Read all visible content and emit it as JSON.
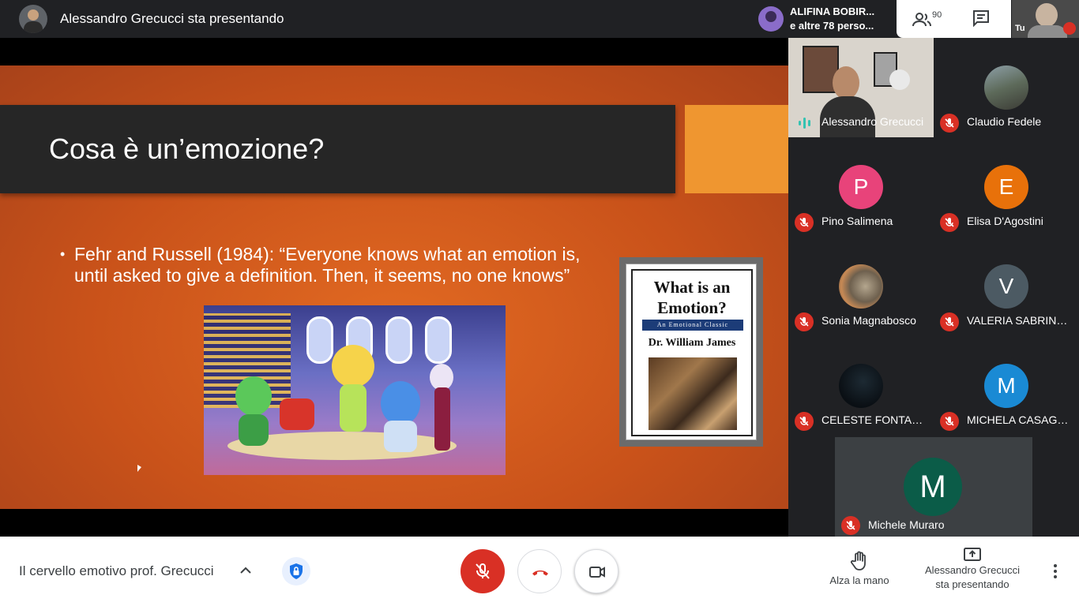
{
  "topbar": {
    "presenter_title": "Alessandro Grecucci sta presentando",
    "people_chip_line1": "ALIFINA BOBIR...",
    "people_chip_line2": "e altre 78 perso...",
    "participant_count": "90",
    "self_label": "Tu"
  },
  "slide": {
    "title": "Cosa è un’emozione?",
    "bullet": "Fehr and Russell (1984): “Everyone knows what an emotion is, until asked to give a definition. Then, it seems, no one knows”",
    "book": {
      "title": "What is an Emotion?",
      "subtitle": "An Emotional Classic",
      "author": "Dr. William James"
    }
  },
  "participants": [
    {
      "name": "Alessandro Grecucci",
      "type": "video",
      "speaking": true
    },
    {
      "name": "Claudio Fedele",
      "type": "photo",
      "muted": true
    },
    {
      "name": "Pino Salimena",
      "initial": "P",
      "color": "#e8437a",
      "muted": true
    },
    {
      "name": "Elisa D'Agostini",
      "initial": "E",
      "color": "#e8710a",
      "muted": true
    },
    {
      "name": "Sonia Magnabosco",
      "type": "photo",
      "muted": true
    },
    {
      "name": "VALERIA SABRINA ...",
      "initial": "V",
      "color": "#4c5a63",
      "muted": true
    },
    {
      "name": "CELESTE FONTAN...",
      "type": "photo",
      "muted": true
    },
    {
      "name": "MICHELA CASAGR...",
      "initial": "M",
      "color": "#1a8ad4",
      "muted": true
    },
    {
      "name": "Michele Muraro",
      "initial": "M",
      "color": "#0b5c48",
      "muted": true
    }
  ],
  "bottombar": {
    "meeting_name": "Il cervello emotivo prof. Grecucci",
    "raise_hand": "Alza la mano",
    "presenting_line1": "Alessandro Grecucci",
    "presenting_line2": "sta presentando"
  }
}
